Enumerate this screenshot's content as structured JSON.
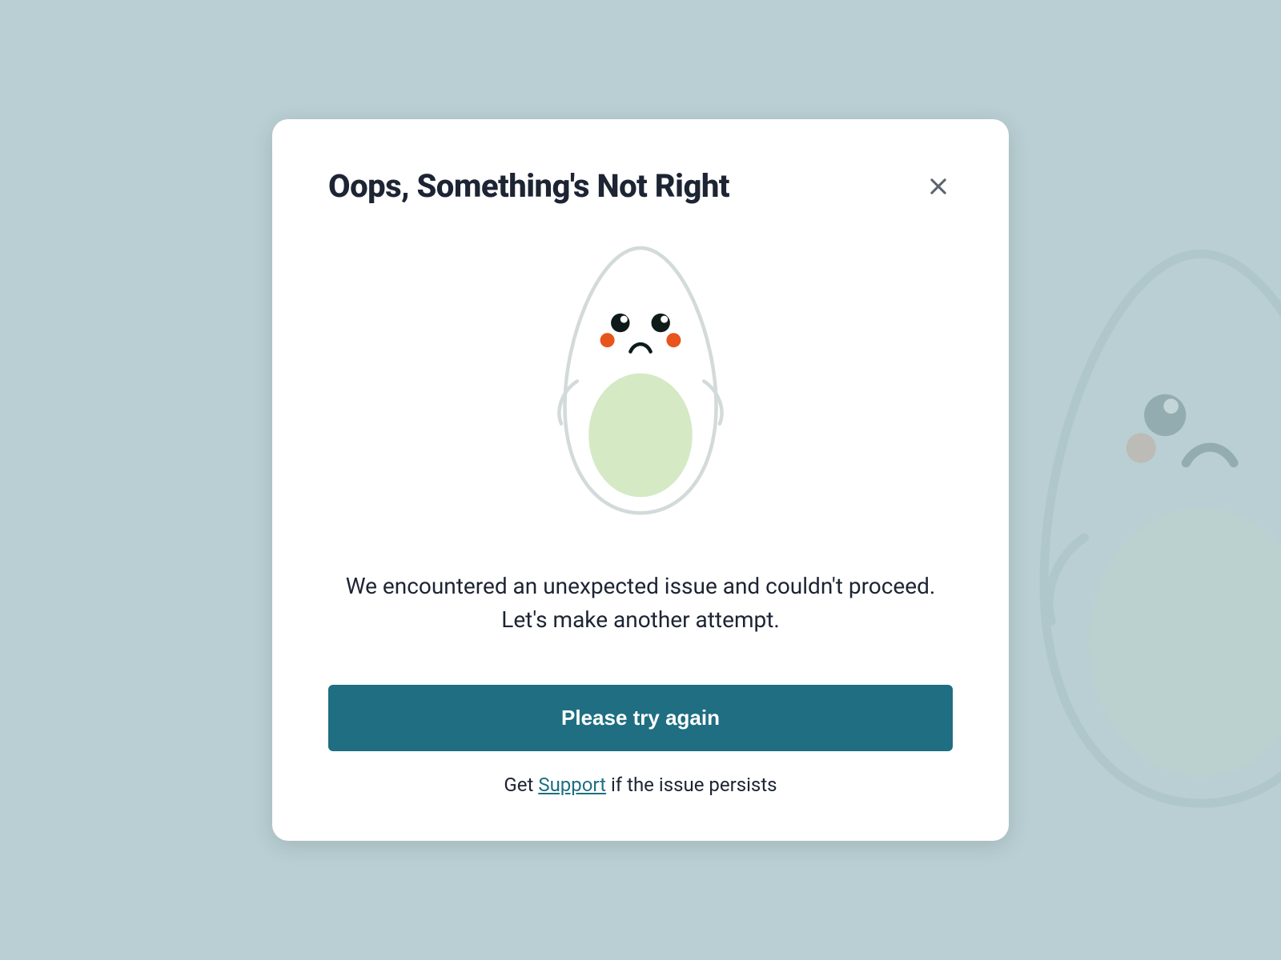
{
  "modal": {
    "title": "Oops, Something's Not Right",
    "message": "We encountered an unexpected issue and couldn't proceed. Let's make another attempt.",
    "primary_button": "Please try again",
    "support_prefix": "Get ",
    "support_link": "Support",
    "support_suffix": " if the issue persists"
  },
  "icons": {
    "close": "close-icon",
    "illustration": "sad-avocado-icon"
  },
  "colors": {
    "background": "#b9cfd3",
    "modal_bg": "#ffffff",
    "primary": "#1f6e82",
    "text": "#1d2433",
    "avocado_pit": "#d5e9c5",
    "avocado_outline": "#cfd6d6",
    "blush": "#e8541e"
  }
}
